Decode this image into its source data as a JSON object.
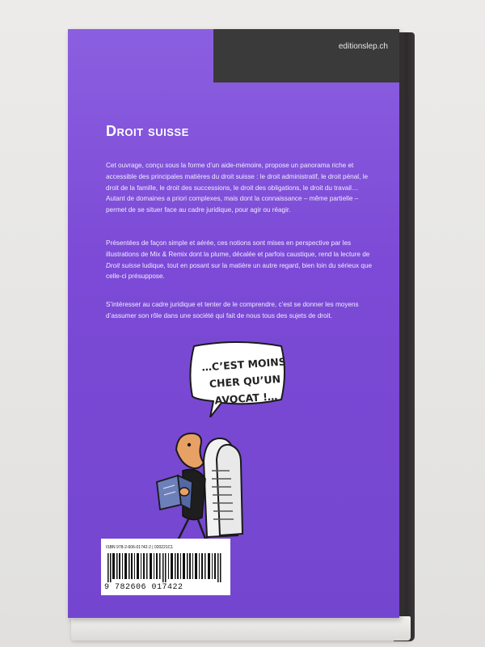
{
  "publisher_url": "editionslep.ch",
  "title": "Droit suisse",
  "paragraphs": {
    "p1": "Cet ouvrage, conçu sous la forme d’un aide-mémoire, propose un panorama riche et accessible des principales matières du droit suisse : le droit administratif, le droit pénal, le droit de la famille, le droit des successions, le droit des obligations, le droit du travail… Autant de domaines a priori complexes, mais dont la connaissance – même partielle – permet de se situer face au cadre juridique, pour agir ou réagir.",
    "p2_before": "Présentées de façon simple et aérée, ces notions sont mises en perspective par les illustrations de Mix & Remix dont la plume, décalée et parfois caustique, rend la lecture de ",
    "p2_emph": "Droit suisse",
    "p2_after": " ludique, tout en posant sur la matière un autre regard, bien loin du sérieux que celle-ci présuppose.",
    "p3": "S’intéresser au cadre juridique et tenter de le comprendre, c’est se donner les moyens d’assumer son rôle dans une société qui fait de nous tous des sujets de droit."
  },
  "speech_bubble": {
    "line1": "…C’EST MOINS",
    "line2": "CHER QU’UN",
    "line3": "AVOCAT !…"
  },
  "barcode": {
    "isbn_line": "ISBN 978-2-606-01742-2 | 020221C1",
    "digits": "9 782606 017422"
  },
  "colors": {
    "cover_purple": "#7c4ad6",
    "band_dark": "#3a3a3a",
    "skin": "#e8a165",
    "text_white": "#ffffff"
  }
}
